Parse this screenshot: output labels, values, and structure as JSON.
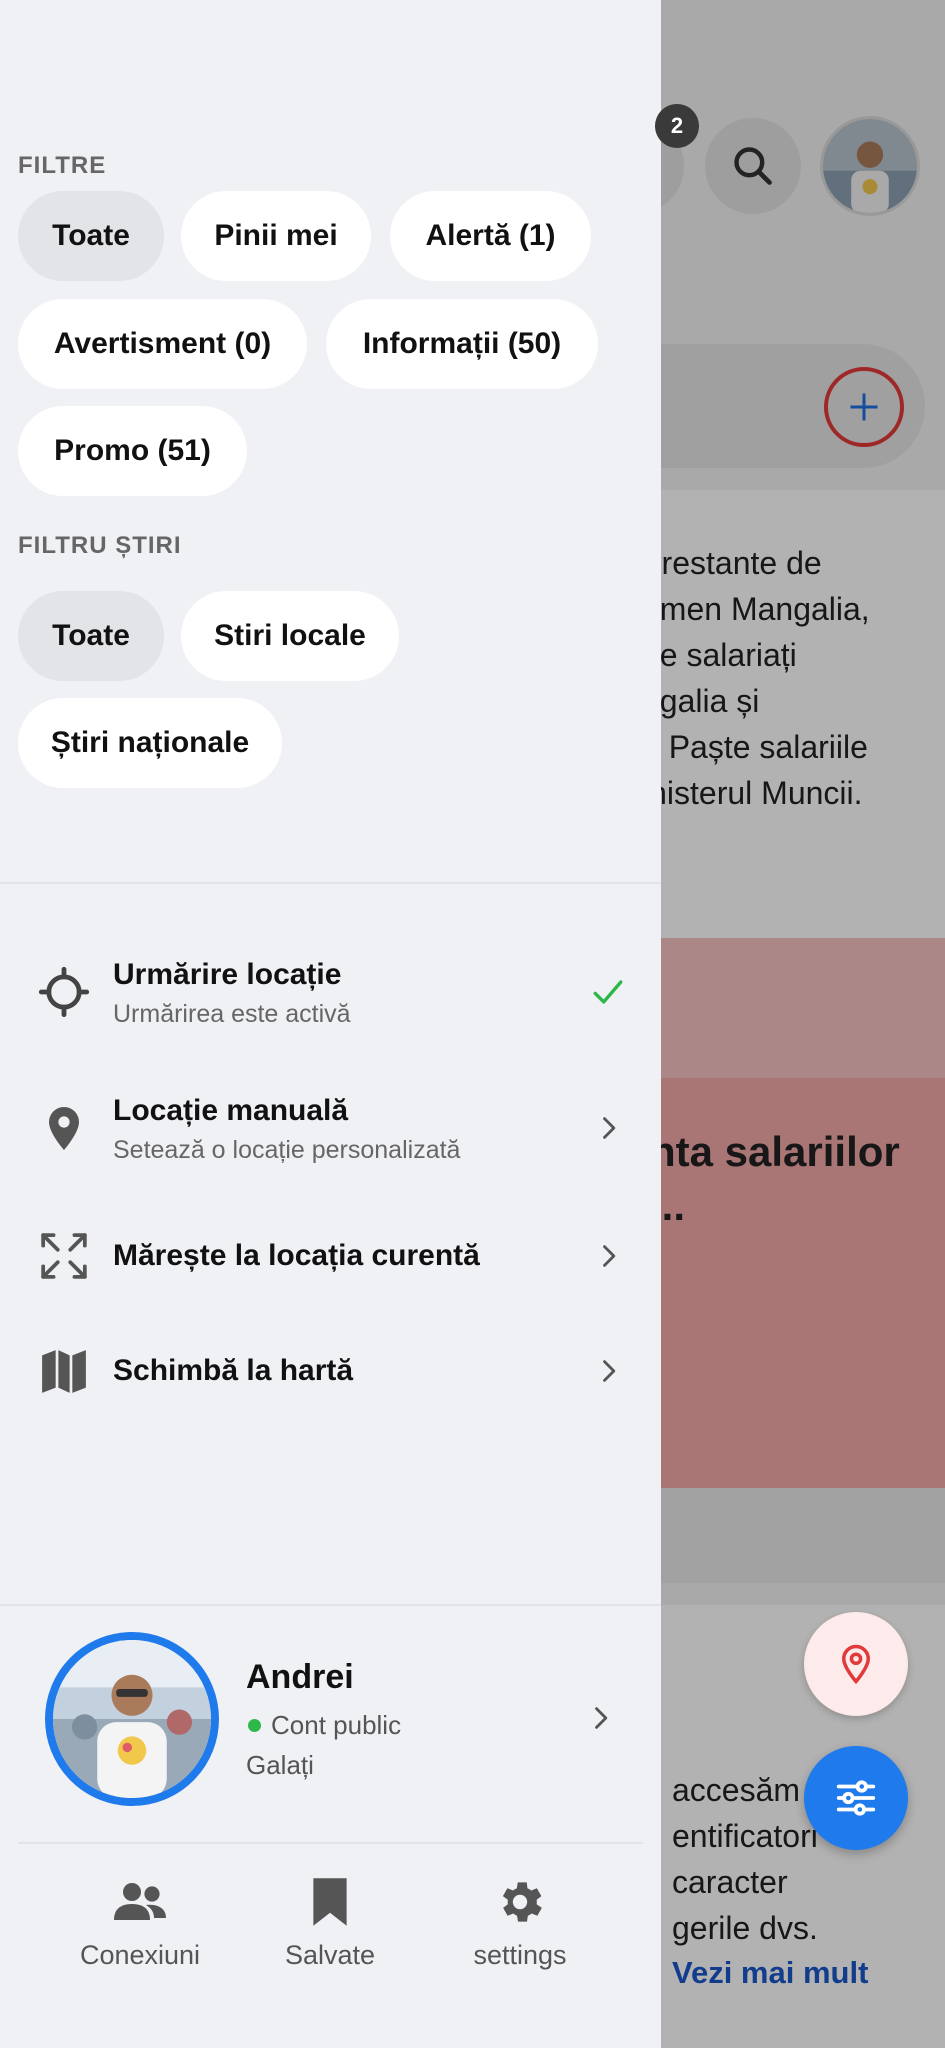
{
  "background": {
    "notification_count": "2",
    "article_text": [
      "r restante de",
      "amen Mangalia,",
      "de salariați",
      "ngalia și",
      "e Paște salariile",
      "inisterul Muncii."
    ],
    "headline": [
      "nta salariilor",
      "..."
    ],
    "bottom_text": [
      "accesăm",
      "entificatori",
      "caracter",
      "gerile dvs."
    ],
    "more_link": "Vezi mai mult"
  },
  "filters": {
    "title": "FILTRE",
    "chips": [
      {
        "label": "Toate",
        "active": true
      },
      {
        "label": "Pinii mei",
        "active": false
      },
      {
        "label": "Alertă (1)",
        "active": false
      },
      {
        "label": "Avertisment (0)",
        "active": false
      },
      {
        "label": "Informații (50)",
        "active": false
      },
      {
        "label": "Promo (51)",
        "active": false
      }
    ]
  },
  "news_filter": {
    "title": "FILTRU ȘTIRI",
    "chips": [
      {
        "label": "Toate",
        "active": true
      },
      {
        "label": "Stiri locale",
        "active": false
      },
      {
        "label": "Știri naționale",
        "active": false
      }
    ]
  },
  "menu": [
    {
      "icon": "crosshair-icon",
      "title": "Urmărire locație",
      "subtitle": "Urmărirea este activă",
      "right": "check-icon"
    },
    {
      "icon": "location-pin-icon",
      "title": "Locație manuală",
      "subtitle": "Setează o locație personalizată",
      "right": "chevron-right-icon"
    },
    {
      "icon": "expand-icon",
      "title": "Mărește la locația curentă",
      "subtitle": "",
      "right": "chevron-right-icon"
    },
    {
      "icon": "map-icon",
      "title": "Schimbă la hartă",
      "subtitle": "",
      "right": "chevron-right-icon"
    }
  ],
  "profile": {
    "name": "Andrei",
    "status": "Cont public",
    "city": "Galați"
  },
  "bottom_nav": [
    {
      "icon": "people-icon",
      "label": "Conexiuni"
    },
    {
      "icon": "bookmark-icon",
      "label": "Salvate"
    },
    {
      "icon": "gear-icon",
      "label": "settings"
    }
  ],
  "colors": {
    "accent": "#1f7aec",
    "check": "#2fb84a",
    "danger": "#e23a3a",
    "drawer_bg": "#f0f1f5"
  }
}
